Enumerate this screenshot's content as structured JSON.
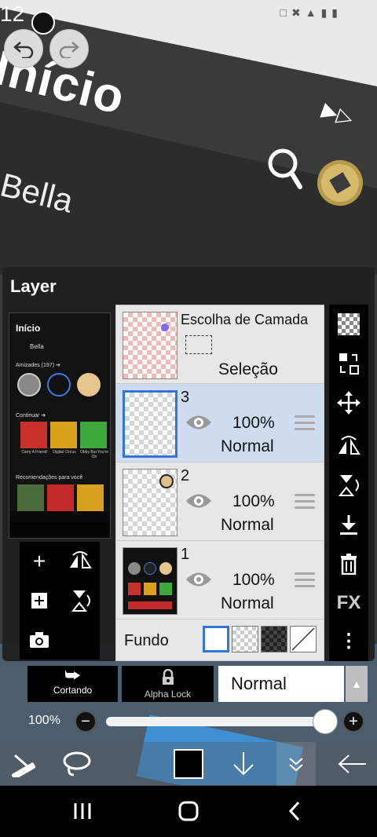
{
  "status": {
    "time": "12"
  },
  "panel": {
    "title": "Layer"
  },
  "preview": {
    "heading": "Início",
    "profile_name": "Bella",
    "friends_label": "Amizades (197) ➔",
    "continue_label": "Continuar ➔",
    "recommendations_label": "Recomendações para você",
    "games": [
      "Carry A Friend!",
      "Digital Circus",
      "Obby But You're On"
    ]
  },
  "selection_layer": {
    "title": "Escolha de Camada",
    "label": "Seleção"
  },
  "layers": [
    {
      "number": "3",
      "opacity": "100%",
      "blend": "Normal",
      "selected": true
    },
    {
      "number": "2",
      "opacity": "100%",
      "blend": "Normal",
      "selected": false
    },
    {
      "number": "1",
      "opacity": "100%",
      "blend": "Normal",
      "selected": false
    }
  ],
  "background": {
    "label": "Fundo",
    "options": [
      "white",
      "checker-light",
      "checker-dark",
      "none"
    ]
  },
  "right_tools": {
    "fx_label": "FX"
  },
  "mode_bar": {
    "clipping_label": "Cortando",
    "alpha_lock_label": "Alpha Lock",
    "blend_mode": "Normal"
  },
  "opacity_control": {
    "label": "100%",
    "value": 1.0
  },
  "colors": {
    "accent": "#2f76d6",
    "selected_row": "#cfdcf0",
    "current_color": "#000000"
  }
}
